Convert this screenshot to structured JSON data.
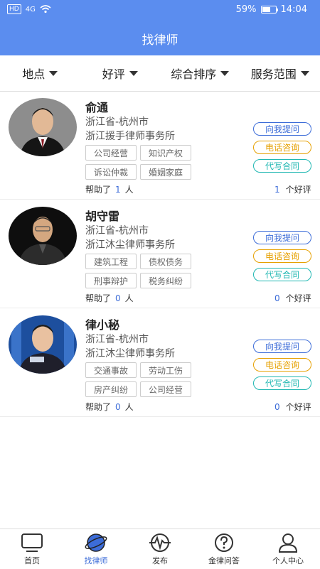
{
  "status_bar": {
    "network": "HD",
    "signal": "4G",
    "battery": "59%",
    "time": "14:04"
  },
  "header": {
    "title": "找律师"
  },
  "filters": [
    "地点",
    "好评",
    "综合排序",
    "服务范围"
  ],
  "action_labels": {
    "ask": "向我提问",
    "call": "电话咨询",
    "contract": "代写合同"
  },
  "labels": {
    "helped_prefix": "帮助了",
    "helped_suffix": "人",
    "rating_suffix": "个好评"
  },
  "lawyers": [
    {
      "name": "俞通",
      "region": "浙江省-杭州市",
      "firm": "浙江援手律师事务所",
      "tags": [
        "公司经营",
        "知识产权",
        "诉讼仲裁",
        "婚姻家庭"
      ],
      "helped": "1",
      "good_reviews": "1"
    },
    {
      "name": "胡守雷",
      "region": "浙江省-杭州市",
      "firm": "浙江沐尘律师事务所",
      "tags": [
        "建筑工程",
        "债权债务",
        "刑事辩护",
        "税务纠纷"
      ],
      "helped": "0",
      "good_reviews": "0"
    },
    {
      "name": "律小秘",
      "region": "浙江省-杭州市",
      "firm": "浙江沐尘律师事务所",
      "tags": [
        "交通事故",
        "劳动工伤",
        "房产纠纷",
        "公司经营"
      ],
      "helped": "0",
      "good_reviews": "0"
    }
  ],
  "tabbar": [
    {
      "label": "首页",
      "icon": "monitor-icon"
    },
    {
      "label": "找律师",
      "icon": "planet-icon",
      "active": true
    },
    {
      "label": "发布",
      "icon": "heartbeat-icon"
    },
    {
      "label": "金律问答",
      "icon": "question-icon"
    },
    {
      "label": "个人中心",
      "icon": "user-icon"
    }
  ],
  "colors": {
    "primary": "#5b8def",
    "accent_blue": "#3c6cd8",
    "accent_orange": "#e6a000",
    "accent_teal": "#1fb7b2"
  }
}
